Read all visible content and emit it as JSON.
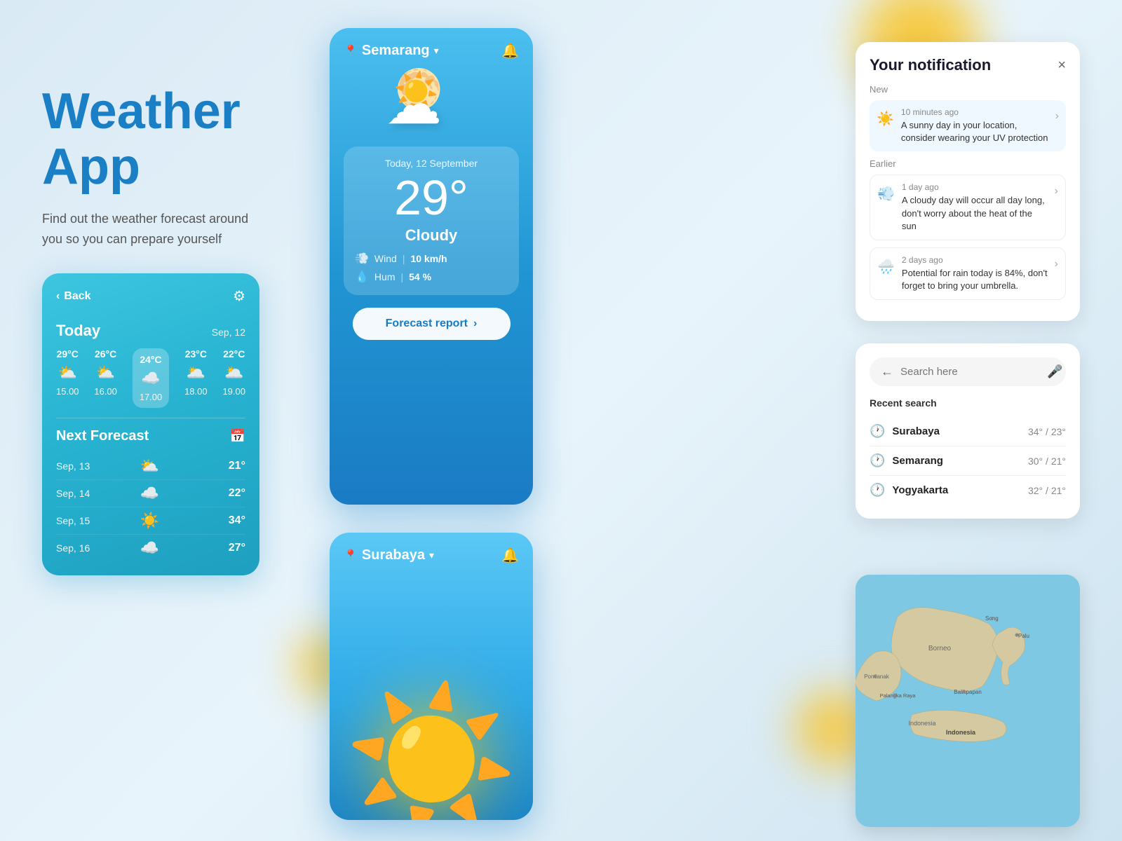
{
  "hero": {
    "title": "Weather\nApp",
    "subtitle": "Find out the weather forecast around you so you can prepare yourself"
  },
  "leftCard": {
    "back": "Back",
    "today": "Today",
    "date": "Sep, 12",
    "hourly": [
      {
        "temp": "29°C",
        "icon": "⛅",
        "time": "15.00"
      },
      {
        "temp": "26°C",
        "icon": "⛅",
        "time": "16.00"
      },
      {
        "temp": "24°C",
        "icon": "☁️",
        "time": "17.00",
        "selected": true
      },
      {
        "temp": "23°C",
        "icon": "🌥️",
        "time": "18.00"
      },
      {
        "temp": "22°C",
        "icon": "🌥️",
        "time": "19.00"
      }
    ],
    "nextForecast": "Next Forecast",
    "forecast": [
      {
        "date": "Sep, 13",
        "icon": "⛅",
        "temp": "21°"
      },
      {
        "date": "Sep, 14",
        "icon": "☁️",
        "temp": "22°"
      },
      {
        "date": "Sep, 15",
        "icon": "☀️",
        "temp": "34°"
      },
      {
        "date": "Sep, 16",
        "icon": "☁️",
        "temp": "27°"
      }
    ]
  },
  "centerTop": {
    "location": "Semarang",
    "dateLabel": "Today, 12 September",
    "temp": "29°",
    "condition": "Cloudy",
    "wind": "10 km/h",
    "hum": "54 %",
    "forecastBtn": "Forecast report"
  },
  "centerBottom": {
    "location": "Surabaya"
  },
  "notification": {
    "title": "Your notification",
    "newLabel": "New",
    "earlierLabel": "Earlier",
    "items": [
      {
        "time": "10 minutes ago",
        "text": "A sunny day in your location, consider wearing your UV protection",
        "icon": "☀️",
        "section": "new"
      },
      {
        "time": "1 day ago",
        "text": "A cloudy day will occur all day long, don't worry about the heat of the sun",
        "icon": "💨",
        "section": "earlier"
      },
      {
        "time": "2 days ago",
        "text": "Potential for rain today is 84%, don't forget to bring your umbrella.",
        "icon": "🌧️",
        "section": "earlier"
      }
    ]
  },
  "search": {
    "placeholder": "Search here",
    "recentLabel": "Recent search",
    "results": [
      {
        "city": "Surabaya",
        "temp": "34° / 23°"
      },
      {
        "city": "Semarang",
        "temp": "30° / 21°"
      },
      {
        "city": "Yogyakarta",
        "temp": "32° / 21°"
      }
    ]
  }
}
